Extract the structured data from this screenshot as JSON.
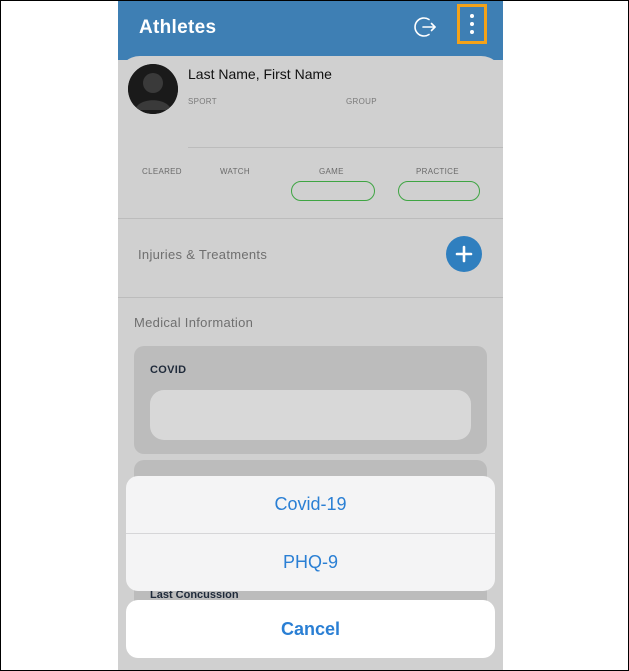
{
  "header": {
    "title": "Athletes",
    "logout_icon": "logout-arrow-icon",
    "more_icon": "vertical-ellipsis-icon",
    "bar_color": "#3e7fb4",
    "highlight_color": "#f3a21a"
  },
  "athlete": {
    "name": "Last Name, First Name",
    "sport_label": "SPORT",
    "group_label": "GROUP"
  },
  "status": {
    "cleared": "CLEARED",
    "watch": "WATCH",
    "game": "GAME",
    "practice": "PRACTICE",
    "pill_color": "#3fa543"
  },
  "injuries": {
    "title": "Injuries & Treatments",
    "add_icon": "plus-circle-icon"
  },
  "medical": {
    "title": "Medical Information",
    "covid_title": "COVID",
    "last_concussion": "Last Concussion"
  },
  "action_sheet": {
    "options": [
      "Covid-19",
      "PHQ-9"
    ],
    "cancel": "Cancel",
    "accent_color": "#2a7fd4"
  }
}
